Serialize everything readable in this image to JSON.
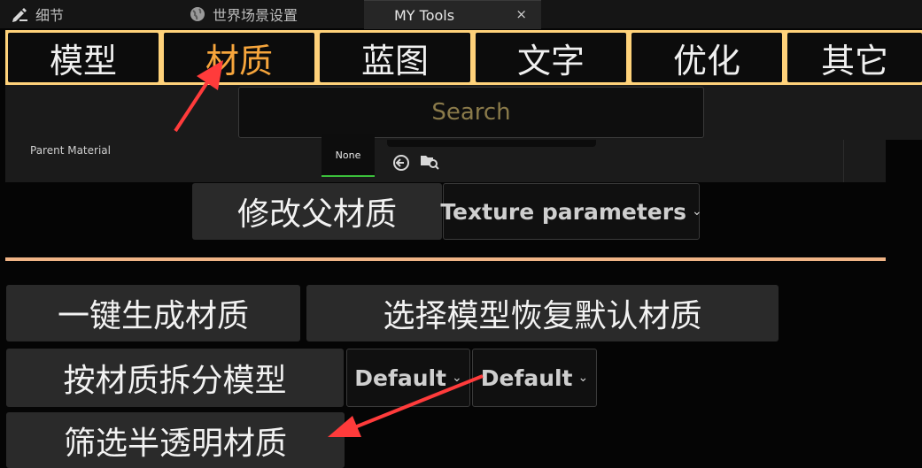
{
  "tabs": {
    "details": "细节",
    "world_settings": "世界场景设置",
    "my_tools": "MY Tools",
    "close_glyph": "×"
  },
  "categories": [
    {
      "label": "模型",
      "active": false
    },
    {
      "label": "材质",
      "active": true
    },
    {
      "label": "蓝图",
      "active": false
    },
    {
      "label": "文字",
      "active": false
    },
    {
      "label": "优化",
      "active": false
    },
    {
      "label": "其它",
      "active": false
    }
  ],
  "search": {
    "placeholder": "Search"
  },
  "parent_material": {
    "label": "Parent Material",
    "thumbnail_text": "None"
  },
  "buttons": {
    "modify_parent": "修改父材质",
    "texture_params": "Texture parameters",
    "one_click_generate": "一键生成材质",
    "restore_default": "选择模型恢复默认材质",
    "split_by_material": "按材质拆分模型",
    "filter_translucent": "筛选半透明材质"
  },
  "dropdowns": {
    "default_1": "Default",
    "default_2": "Default",
    "chevron": "⌄"
  },
  "colors": {
    "category_border": "#ffd27a",
    "active_category_text": "#f6a53c",
    "divider": "#f0b486",
    "annotation_arrow": "#ff3b3b",
    "active_indicator": "#3bbf3b"
  }
}
